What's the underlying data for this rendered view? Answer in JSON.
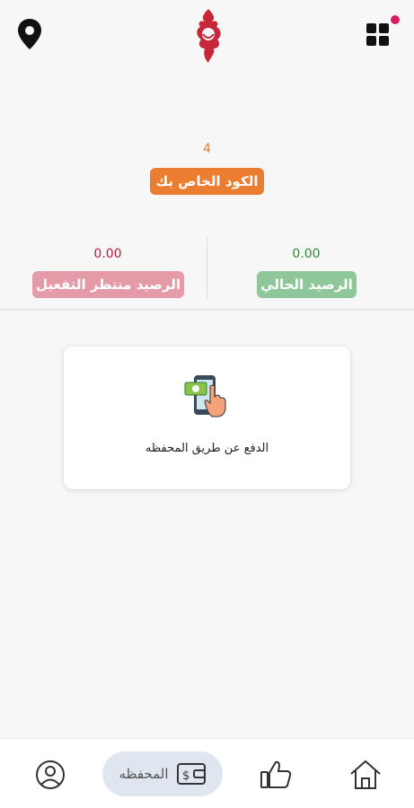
{
  "header": {
    "location_icon": "location-pin-icon",
    "grid_icon": "apps-grid-icon",
    "notification_dot_color": "#d81b60",
    "logo": "brand-logo"
  },
  "code": {
    "value": "4",
    "label": "الكود الخاص بك"
  },
  "balances": {
    "current": {
      "value": "0.00",
      "label": "الرصيد الحالي"
    },
    "pending": {
      "value": "0.00",
      "label": "الرصيد منتظر التفعيل"
    }
  },
  "payment_card": {
    "icon": "mobile-payment-icon",
    "label": "الدفع عن طريق المحفظه"
  },
  "bottom_nav": {
    "profile_icon": "profile-icon",
    "wallet": {
      "icon": "wallet-icon",
      "label": "المحفظه"
    },
    "like_icon": "thumbs-up-icon",
    "home_icon": "home-icon"
  },
  "colors": {
    "accent_orange": "#ea7d2f",
    "current_green": "#8fc79a",
    "pending_pink": "#e59aa8",
    "brand_red": "#c62839"
  }
}
